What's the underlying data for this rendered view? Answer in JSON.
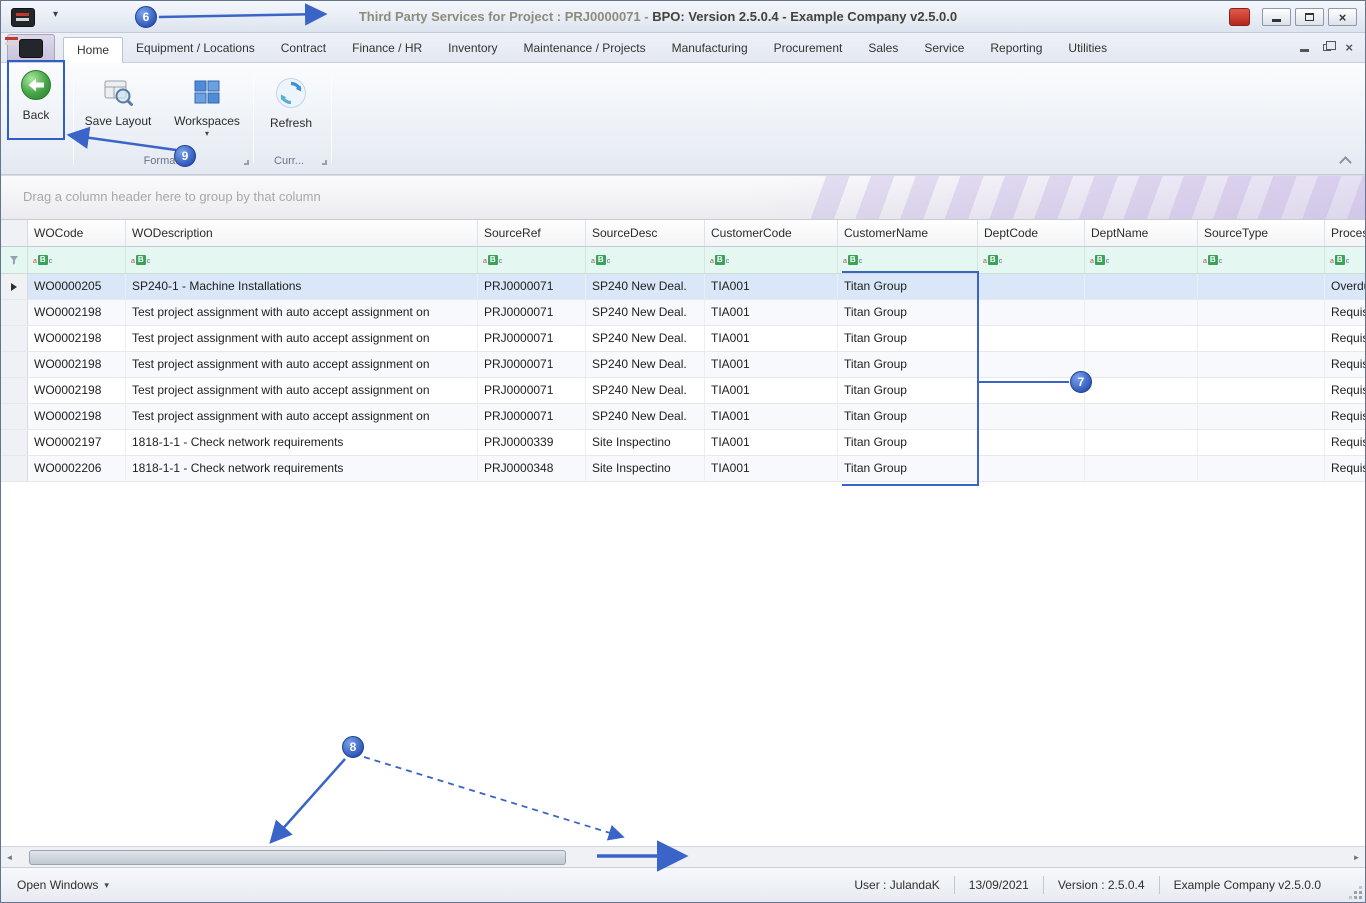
{
  "titlebar": {
    "title_part1": "Third Party Services for Project : PRJ0000071",
    "title_separator": " - ",
    "title_part2": "BPO: Version 2.5.0.4 - Example Company v2.5.0.0"
  },
  "ribbon": {
    "active_tab": "Home",
    "tabs": [
      "Home",
      "Equipment / Locations",
      "Contract",
      "Finance / HR",
      "Inventory",
      "Maintenance / Projects",
      "Manufacturing",
      "Procurement",
      "Sales",
      "Service",
      "Reporting",
      "Utilities"
    ],
    "buttons": {
      "back": "Back",
      "save_layout": "Save Layout",
      "workspaces": "Workspaces",
      "refresh": "Refresh"
    },
    "groups": {
      "format": "Format",
      "current": "Curr..."
    }
  },
  "grid": {
    "group_hint": "Drag a column header here to group by that column",
    "columns": [
      "WOCode",
      "WODescription",
      "SourceRef",
      "SourceDesc",
      "CustomerCode",
      "CustomerName",
      "DeptCode",
      "DeptName",
      "SourceType",
      "Process"
    ],
    "rows": [
      {
        "selected": true,
        "cells": [
          "WO0000205",
          "SP240-1 - Machine Installations",
          "PRJ0000071",
          "SP240 New Deal.",
          "TIA001",
          "Titan Group",
          "",
          "",
          "",
          "Overdu"
        ]
      },
      {
        "selected": false,
        "cells": [
          "WO0002198",
          "Test project assignment with auto accept assignment on",
          "PRJ0000071",
          "SP240 New Deal.",
          "TIA001",
          "Titan Group",
          "",
          "",
          "",
          "Requisi"
        ]
      },
      {
        "selected": false,
        "cells": [
          "WO0002198",
          "Test project assignment with auto accept assignment on",
          "PRJ0000071",
          "SP240 New Deal.",
          "TIA001",
          "Titan Group",
          "",
          "",
          "",
          "Requisi"
        ]
      },
      {
        "selected": false,
        "cells": [
          "WO0002198",
          "Test project assignment with auto accept assignment on",
          "PRJ0000071",
          "SP240 New Deal.",
          "TIA001",
          "Titan Group",
          "",
          "",
          "",
          "Requisi"
        ]
      },
      {
        "selected": false,
        "cells": [
          "WO0002198",
          "Test project assignment with auto accept assignment on",
          "PRJ0000071",
          "SP240 New Deal.",
          "TIA001",
          "Titan Group",
          "",
          "",
          "",
          "Requisi"
        ]
      },
      {
        "selected": false,
        "cells": [
          "WO0002198",
          "Test project assignment with auto accept assignment on",
          "PRJ0000071",
          "SP240 New Deal.",
          "TIA001",
          "Titan Group",
          "",
          "",
          "",
          "Requisi"
        ]
      },
      {
        "selected": false,
        "cells": [
          "WO0002197",
          "1818-1-1 - Check network requirements",
          "PRJ0000339",
          "Site Inspectino",
          "TIA001",
          "Titan Group",
          "",
          "",
          "",
          "Requisi"
        ]
      },
      {
        "selected": false,
        "cells": [
          "WO0002206",
          "1818-1-1 - Check network requirements",
          "PRJ0000348",
          "Site Inspectino",
          "TIA001",
          "Titan Group",
          "",
          "",
          "",
          "Requisi"
        ]
      }
    ]
  },
  "statusbar": {
    "open_windows": "Open Windows",
    "segments": [
      "User : JulandaK",
      "13/09/2021",
      "Version : 2.5.0.4",
      "Example Company v2.5.0.0"
    ]
  },
  "annotations": {
    "badge6": "6",
    "badge7": "7",
    "badge8": "8",
    "badge9": "9"
  }
}
